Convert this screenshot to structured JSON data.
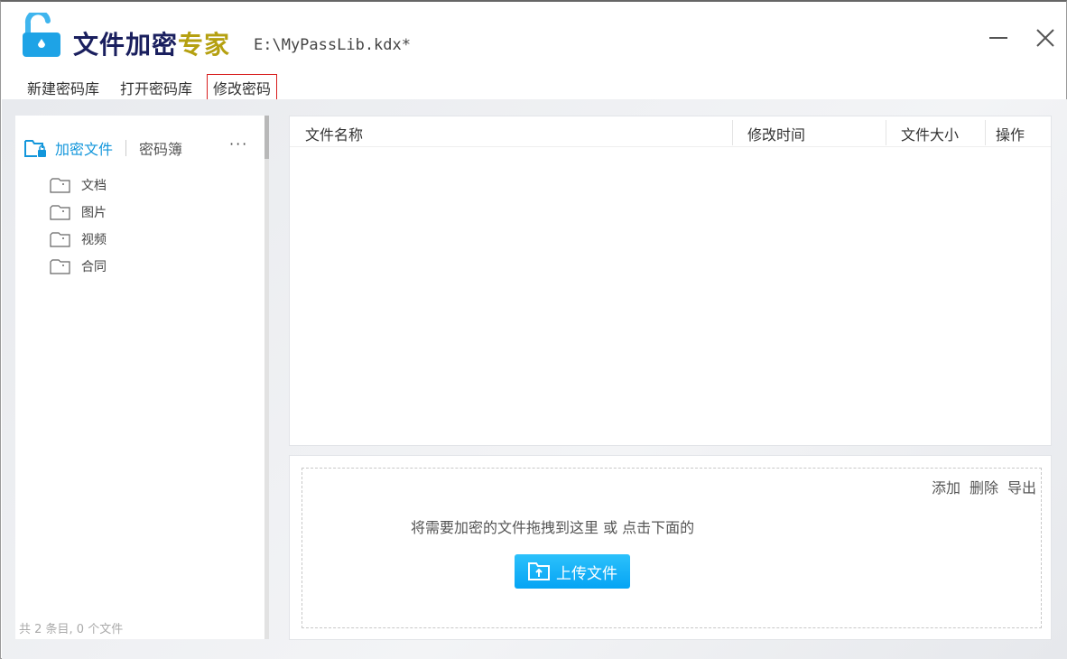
{
  "app": {
    "title_main": "文件加密",
    "title_accent": "专家",
    "file_path": "E:\\MyPassLib.kdx*"
  },
  "menu": [
    {
      "label": "新建密码库"
    },
    {
      "label": "打开密码库"
    },
    {
      "label": "修改密码"
    }
  ],
  "sidebar": {
    "tab_files": "加密文件",
    "tab_passbook": "密码簿",
    "more": "···",
    "folders": [
      {
        "label": "文档"
      },
      {
        "label": "图片"
      },
      {
        "label": "视频"
      },
      {
        "label": "合同"
      }
    ],
    "footer": "共 2 条目, 0 个文件"
  },
  "table": {
    "columns": [
      "文件名称",
      "修改时间",
      "文件大小",
      "操作"
    ]
  },
  "dropzone": {
    "actions": [
      "添加",
      "删除",
      "导出"
    ],
    "hint": "将需要加密的文件拖拽到这里 或 点击下面的",
    "upload_label": "上传文件"
  },
  "colors": {
    "accent": "#1296db",
    "title": "#1a1f5e",
    "title_accent": "#b5a010",
    "highlight": "#d81e1e"
  }
}
